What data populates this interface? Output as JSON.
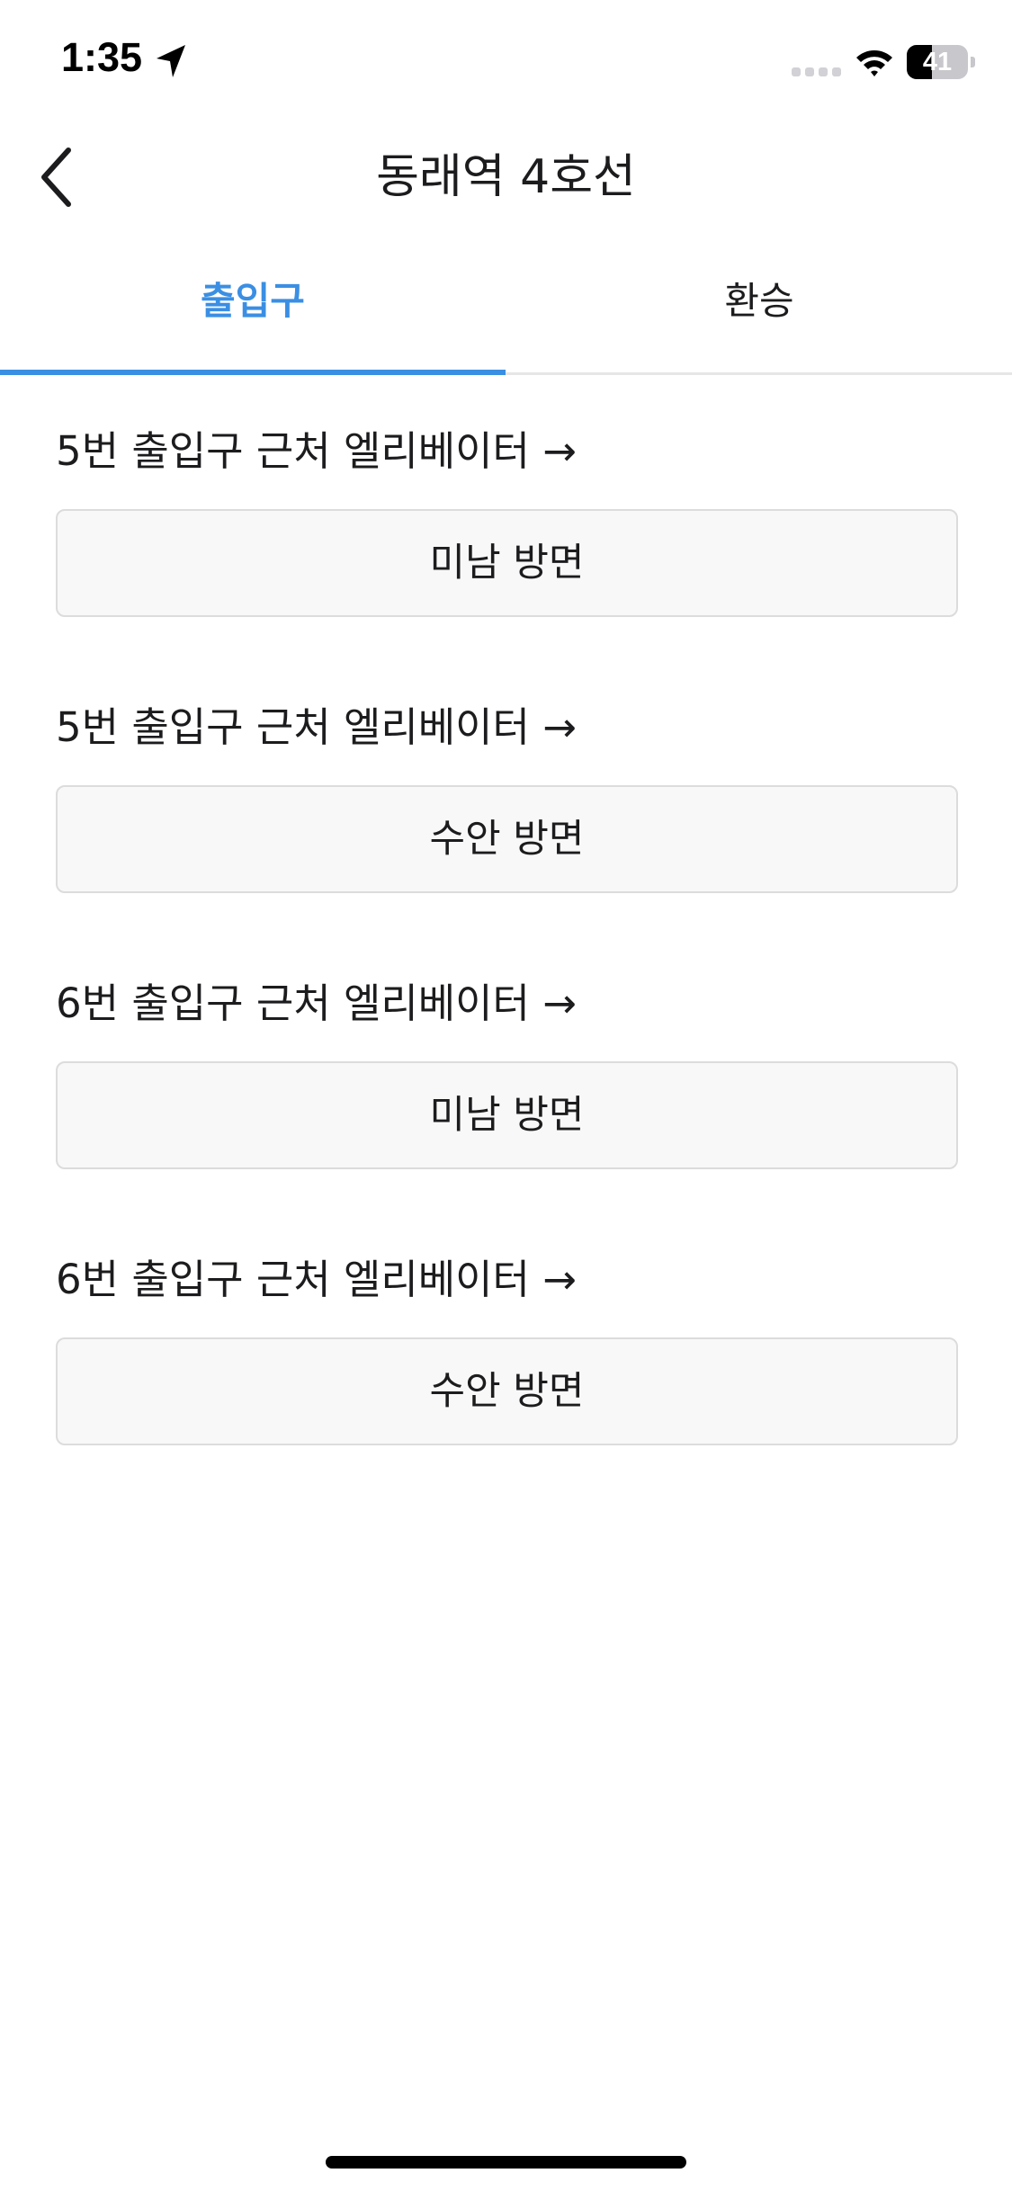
{
  "status_bar": {
    "time": "1:35",
    "battery_level": "41",
    "battery_fraction": 0.41,
    "icons": [
      "location-arrow-icon",
      "cellular-signal-icon",
      "wifi-icon",
      "battery-icon"
    ]
  },
  "header": {
    "title": "동래역 4호선",
    "back_icon": "chevron-left-icon"
  },
  "tabs": [
    {
      "label": "출입구",
      "active": true
    },
    {
      "label": "환승",
      "active": false
    }
  ],
  "colors": {
    "accent": "#3a8fe3",
    "button_bg": "#f8f8f8",
    "button_border": "#dcdcdc",
    "text": "#1c1c1e"
  },
  "sections": [
    {
      "heading": "5번 출입구 근처 엘리베이터 →",
      "direction": "미남 방면"
    },
    {
      "heading": "5번 출입구 근처 엘리베이터 →",
      "direction": "수안 방면"
    },
    {
      "heading": "6번 출입구 근처 엘리베이터 →",
      "direction": "미남 방면"
    },
    {
      "heading": "6번 출입구 근처 엘리베이터 →",
      "direction": "수안 방면"
    }
  ]
}
